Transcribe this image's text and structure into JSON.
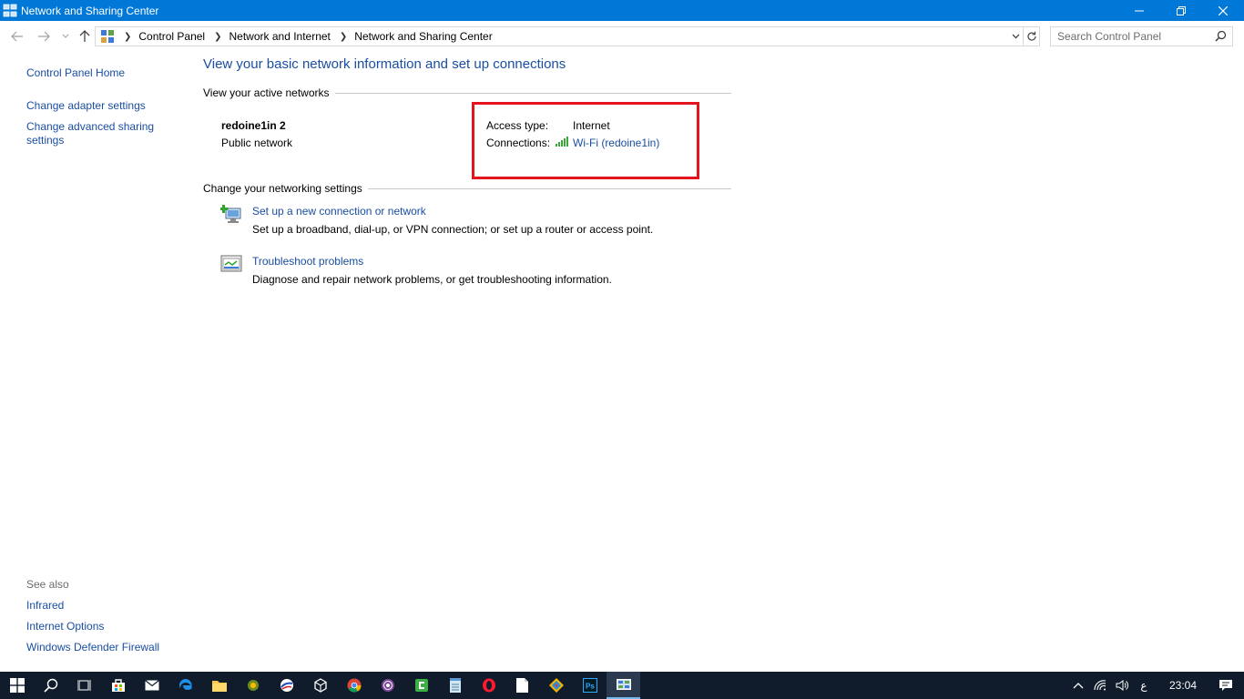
{
  "window": {
    "title": "Network and Sharing Center"
  },
  "address": {
    "crumbs": [
      "Control Panel",
      "Network and Internet",
      "Network and Sharing Center"
    ]
  },
  "search": {
    "placeholder": "Search Control Panel"
  },
  "left_pane": {
    "home": "Control Panel Home",
    "links": [
      "Change adapter settings",
      "Change advanced sharing settings"
    ],
    "see_also_label": "See also",
    "see_also": [
      "Infrared",
      "Internet Options",
      "Windows Defender Firewall"
    ]
  },
  "main": {
    "title": "View your basic network information and set up connections",
    "active_networks_header": "View your active networks",
    "network": {
      "name": "redoine1in 2",
      "type": "Public network",
      "access_type_label": "Access type:",
      "access_type_value": "Internet",
      "connections_label": "Connections:",
      "connections_value": "Wi-Fi (redoine1in)"
    },
    "settings_header": "Change your networking settings",
    "tasks": [
      {
        "link": "Set up a new connection or network",
        "desc": "Set up a broadband, dial-up, or VPN connection; or set up a router or access point.",
        "icon": "new-connection-icon"
      },
      {
        "link": "Troubleshoot problems",
        "desc": "Diagnose and repair network problems, or get troubleshooting information.",
        "icon": "troubleshoot-icon"
      }
    ]
  },
  "taskbar": {
    "clock": "23:04",
    "language": "ع"
  },
  "colors": {
    "accent": "#0078d7",
    "link": "#1a4ea2",
    "highlight": "#e3141e",
    "taskbar": "#101c2c"
  }
}
